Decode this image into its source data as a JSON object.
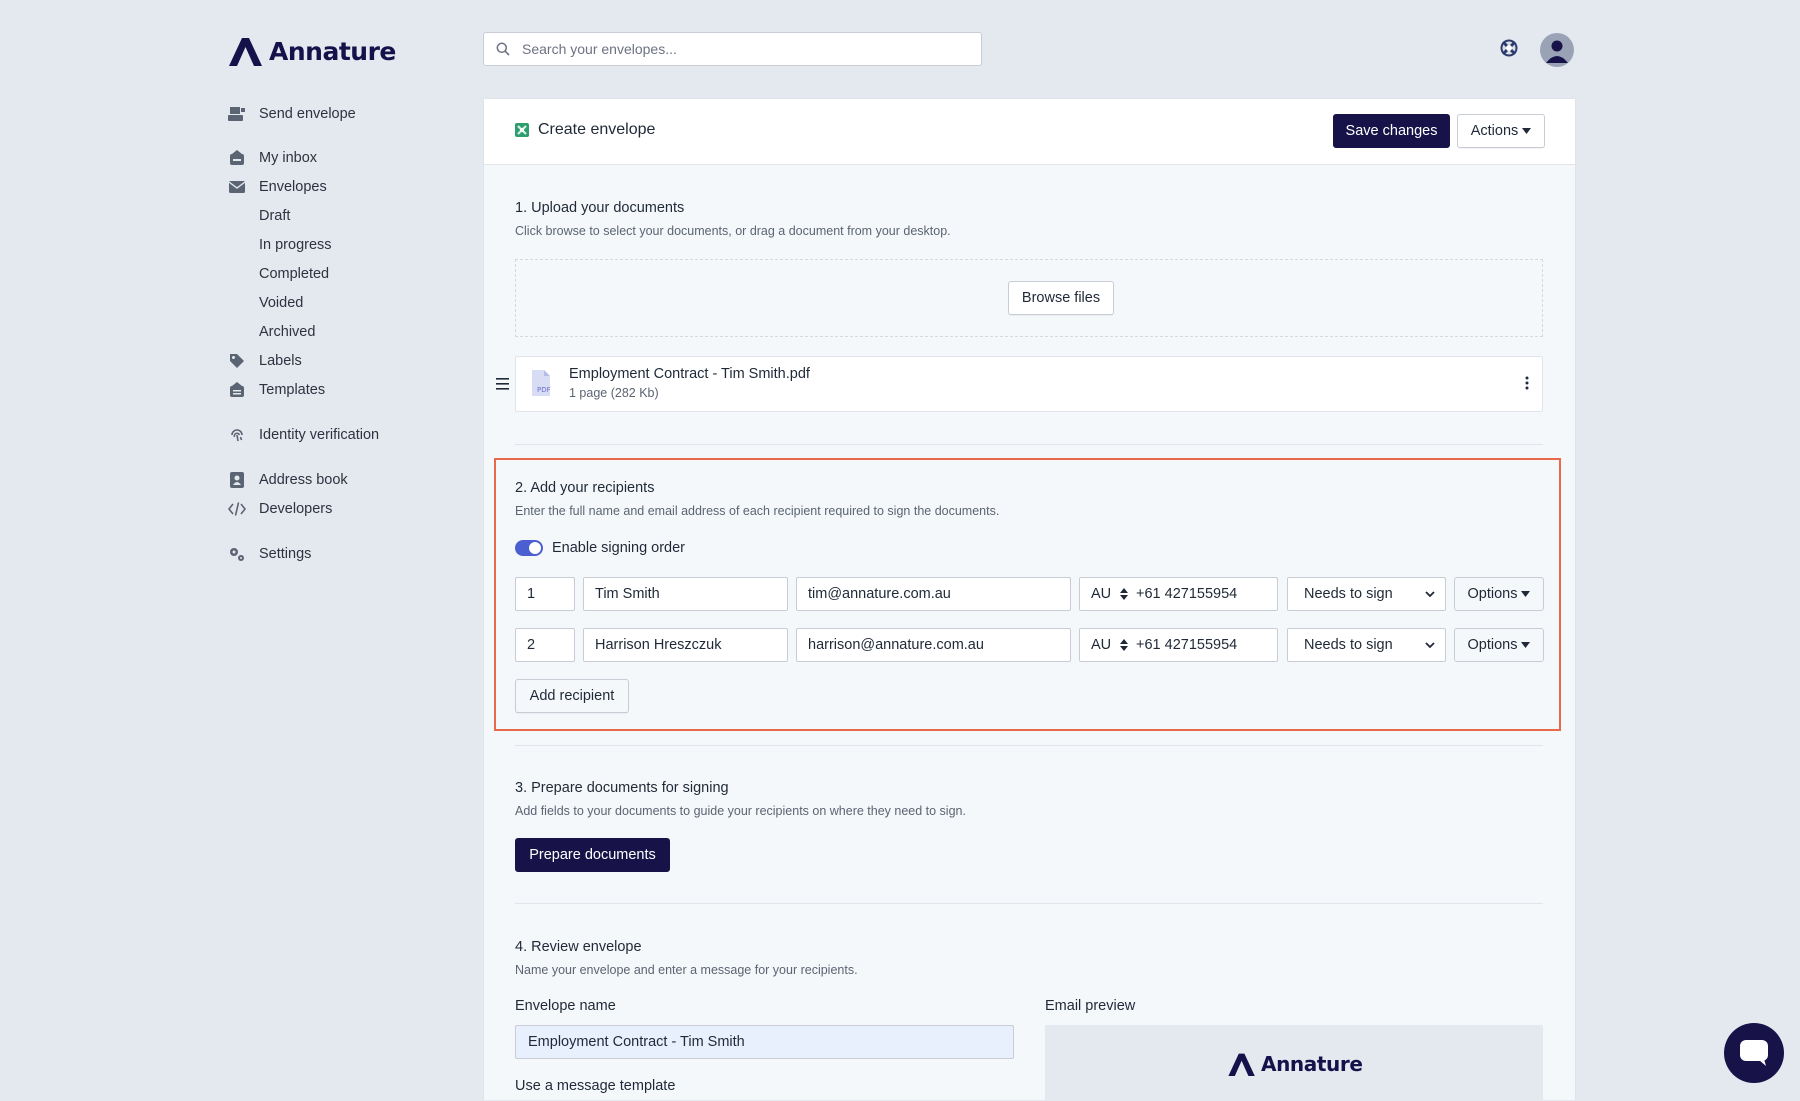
{
  "brand": {
    "name": "Annature",
    "color": "#15114a"
  },
  "search": {
    "placeholder": "Search your envelopes..."
  },
  "header_icons": [
    "support-icon",
    "user-avatar-icon"
  ],
  "sidebar": {
    "send_envelope": "Send envelope",
    "my_inbox": "My inbox",
    "envelopes": "Envelopes",
    "draft": "Draft",
    "in_progress": "In progress",
    "completed": "Completed",
    "voided": "Voided",
    "archived": "Archived",
    "labels": "Labels",
    "templates": "Templates",
    "identity_verification": "Identity verification",
    "address_book": "Address book",
    "developers": "Developers",
    "settings": "Settings"
  },
  "card": {
    "title": "Create envelope",
    "save_label": "Save changes",
    "actions_label": "Actions"
  },
  "upload": {
    "title": "1. Upload your documents",
    "desc": "Click browse to select your documents, or drag a document from your desktop.",
    "browse_label": "Browse files",
    "file": {
      "name": "Employment Contract - Tim Smith.pdf",
      "meta": "1 page (282 Kb)",
      "badge": "PDF"
    }
  },
  "recipients": {
    "title": "2. Add your recipients",
    "desc": "Enter the full name and email address of each recipient required to sign the documents.",
    "signing_order_label": "Enable signing order",
    "signing_order_enabled": true,
    "rows": [
      {
        "order": "1",
        "name": "Tim Smith",
        "email": "tim@annature.com.au",
        "country": "AU",
        "phone": "+61 427155954",
        "role": "Needs to sign",
        "options_label": "Options"
      },
      {
        "order": "2",
        "name": "Harrison Hreszczuk",
        "email": "harrison@annature.com.au",
        "country": "AU",
        "phone": "+61 427155954",
        "role": "Needs to sign",
        "options_label": "Options"
      }
    ],
    "add_label": "Add recipient",
    "highlight_color": "#e86a4a"
  },
  "prepare": {
    "title": "3. Prepare documents for signing",
    "desc": "Add fields to your documents to guide your recipients on where they need to sign.",
    "button_label": "Prepare documents"
  },
  "review": {
    "title": "4. Review envelope",
    "desc": "Name your envelope and enter a message for your recipients.",
    "envelope_name_label": "Envelope name",
    "envelope_name_value": "Employment Contract - Tim Smith",
    "email_preview_label": "Email preview",
    "message_template_label": "Use a message template",
    "preview_brand": "Annature"
  },
  "colors": {
    "primary": "#171348",
    "accent": "#4b5fd1",
    "background": "#e4e8ef"
  }
}
